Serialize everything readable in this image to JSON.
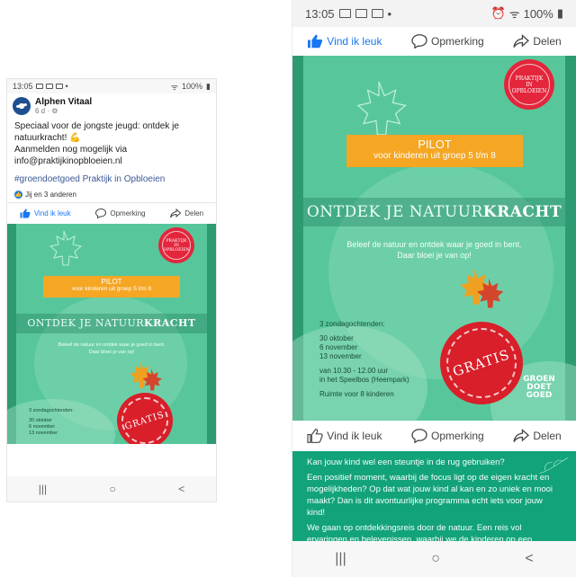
{
  "status": {
    "time": "13:05",
    "battery": "100%"
  },
  "post": {
    "page_name": "Alphen Vitaal",
    "meta": "6 d · ⚙",
    "text_lines": [
      "Speciaal voor de jongste jeugd: ontdek je",
      "natuurkracht! 💪",
      "Aanmelden nog mogelijk via",
      "info@praktijkinopbloeien.nl"
    ],
    "hashtags": "#groendoetgoed Praktijk in Opbloeien",
    "reactions": "Jij en 3 anderen"
  },
  "actions": {
    "like": "Vind ik leuk",
    "comment": "Opmerking",
    "share": "Delen"
  },
  "poster": {
    "seal_line1": "PRAKTIJK",
    "seal_line2": "IN",
    "seal_line3": "OPBLOEIEN",
    "pilot": "PILOT",
    "pilot_sub": "voor kinderen uit groep 5 t/m 8",
    "band_prefix": "ONTDEK JE NATUUR",
    "band_bold": "KRACHT",
    "tagline1": "Beleef de natuur en ontdek waar je goed in bent.",
    "tagline2": "Daar bloei je van op!",
    "schedule_title": "3 zondagochtenden:",
    "dates": [
      "30 oktober",
      "6 november",
      "13 november"
    ],
    "time": "van 10.30 - 12.00 uur",
    "place": "in het Speelbos (Heempark)",
    "capacity": "Ruimte voor 8 kinderen",
    "gratis": "GRATIS",
    "logo1": "GROEN",
    "logo2": "DOET",
    "logo3": "GOED"
  },
  "description": [
    "Kan jouw kind wel een steuntje in de rug gebruiken?",
    "Een positief moment, waarbij de focus ligt op de eigen kracht en mogelijkheden? Op dat wat jouw kind al kan en zo uniek en mooi maakt? Dan is dit avontuurlijke programma echt iets voor jouw kind!",
    "We gaan op ontdekkingsreis door de natuur. Een reis vol ervaringen en belevenissen, waarbij we de kinderen op een speelse manier uitnodigen om te onderzoeken waar ze blij van worden, wat"
  ],
  "nav": {
    "recent": "|||",
    "home": "○",
    "back": "<"
  }
}
